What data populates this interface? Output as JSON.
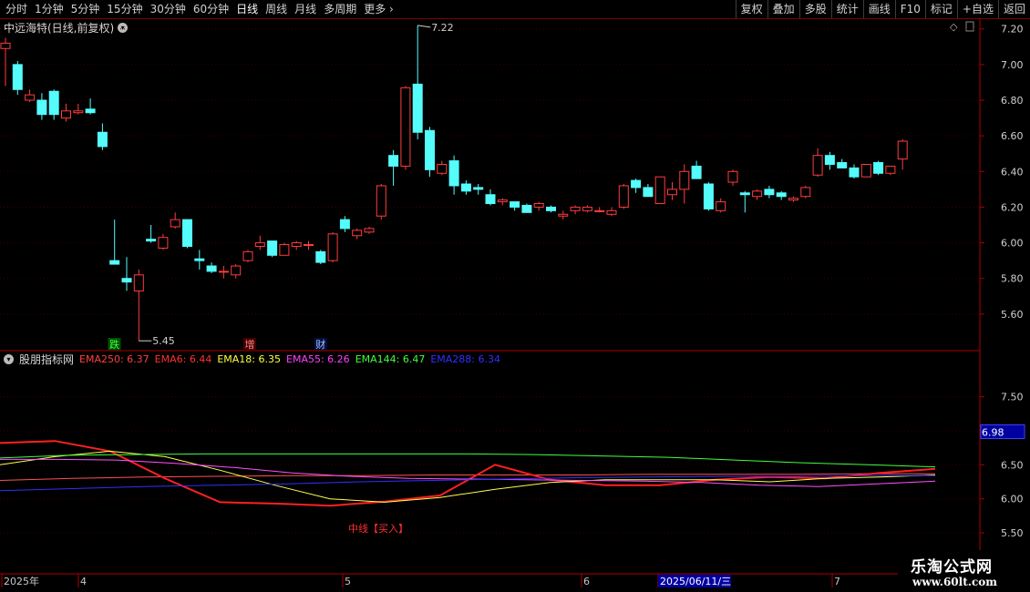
{
  "toolbar": {
    "left": [
      "分时",
      "1分钟",
      "5分钟",
      "15分钟",
      "30分钟",
      "60分钟",
      "日线",
      "周线",
      "月线",
      "多周期",
      "更多"
    ],
    "right": [
      "复权",
      "叠加",
      "多股",
      "统计",
      "画线",
      "F10",
      "标记",
      "+自选",
      "返回"
    ]
  },
  "stock_title": "中远海特(日线,前复权)",
  "indicator_name": "股朋指标网",
  "indicator_values": [
    {
      "label": "EMA250: 6.37",
      "color": "#ff4040"
    },
    {
      "label": "EMA6: 6.44",
      "color": "#ff3030"
    },
    {
      "label": "EMA18: 6.35",
      "color": "#ffff40"
    },
    {
      "label": "EMA55: 6.26",
      "color": "#ff40ff"
    },
    {
      "label": "EMA144: 6.47",
      "color": "#40ff40"
    },
    {
      "label": "EMA288: 6.34",
      "color": "#3030ff"
    }
  ],
  "colors": {
    "up": "#ff3c3c",
    "down": "#54fcfc",
    "axis": "#aa0000",
    "grid": "#3a0000"
  },
  "icons": {
    "collapse": "circle-chevron-icon",
    "diamond": "diamond-icon"
  },
  "watermark": {
    "line1": "乐淘公式网",
    "line2": "www.60lt.com"
  },
  "chart_data": [
    {
      "type": "candlestick",
      "ylim": [
        5.4,
        7.26
      ],
      "y_ticks": [
        "7.20",
        "7.00",
        "6.80",
        "6.60",
        "6.40",
        "6.20",
        "6.00",
        "5.80",
        "5.60"
      ],
      "high_label": "7.22",
      "low_label": "5.45",
      "candles": [
        {
          "o": 7.09,
          "h": 7.15,
          "l": 6.88,
          "c": 7.12
        },
        {
          "o": 7.0,
          "h": 7.02,
          "l": 6.83,
          "c": 6.86
        },
        {
          "o": 6.8,
          "h": 6.86,
          "l": 6.79,
          "c": 6.83
        },
        {
          "o": 6.8,
          "h": 6.84,
          "l": 6.69,
          "c": 6.72
        },
        {
          "o": 6.85,
          "h": 6.86,
          "l": 6.69,
          "c": 6.72
        },
        {
          "o": 6.7,
          "h": 6.78,
          "l": 6.68,
          "c": 6.74
        },
        {
          "o": 6.73,
          "h": 6.78,
          "l": 6.72,
          "c": 6.74
        },
        {
          "o": 6.75,
          "h": 6.81,
          "l": 6.72,
          "c": 6.73
        },
        {
          "o": 6.62,
          "h": 6.67,
          "l": 6.52,
          "c": 6.54
        },
        {
          "o": 5.9,
          "h": 6.13,
          "l": 5.89,
          "c": 5.88
        },
        {
          "o": 5.8,
          "h": 5.92,
          "l": 5.73,
          "c": 5.78
        },
        {
          "o": 5.73,
          "h": 5.85,
          "l": 5.45,
          "c": 5.82
        },
        {
          "o": 6.02,
          "h": 6.1,
          "l": 6.0,
          "c": 6.01
        },
        {
          "o": 5.97,
          "h": 6.05,
          "l": 5.96,
          "c": 6.03
        },
        {
          "o": 6.09,
          "h": 6.17,
          "l": 6.08,
          "c": 6.13
        },
        {
          "o": 6.13,
          "h": 6.13,
          "l": 5.97,
          "c": 5.98
        },
        {
          "o": 5.91,
          "h": 5.96,
          "l": 5.85,
          "c": 5.9
        },
        {
          "o": 5.87,
          "h": 5.89,
          "l": 5.83,
          "c": 5.84
        },
        {
          "o": 5.84,
          "h": 5.87,
          "l": 5.8,
          "c": 5.84
        },
        {
          "o": 5.82,
          "h": 5.88,
          "l": 5.8,
          "c": 5.87
        },
        {
          "o": 5.9,
          "h": 5.96,
          "l": 5.89,
          "c": 5.95
        },
        {
          "o": 5.98,
          "h": 6.04,
          "l": 5.96,
          "c": 6.0
        },
        {
          "o": 6.01,
          "h": 6.01,
          "l": 5.92,
          "c": 5.93
        },
        {
          "o": 5.93,
          "h": 6.0,
          "l": 5.93,
          "c": 5.99
        },
        {
          "o": 5.98,
          "h": 6.01,
          "l": 5.96,
          "c": 6.0
        },
        {
          "o": 5.99,
          "h": 6.01,
          "l": 5.96,
          "c": 5.99
        },
        {
          "o": 5.95,
          "h": 5.96,
          "l": 5.88,
          "c": 5.89
        },
        {
          "o": 5.9,
          "h": 6.06,
          "l": 5.89,
          "c": 6.05
        },
        {
          "o": 6.13,
          "h": 6.15,
          "l": 6.06,
          "c": 6.08
        },
        {
          "o": 6.04,
          "h": 6.08,
          "l": 6.02,
          "c": 6.07
        },
        {
          "o": 6.06,
          "h": 6.09,
          "l": 6.05,
          "c": 6.08
        },
        {
          "o": 6.15,
          "h": 6.33,
          "l": 6.13,
          "c": 6.32
        },
        {
          "o": 6.49,
          "h": 6.52,
          "l": 6.32,
          "c": 6.43
        },
        {
          "o": 6.43,
          "h": 6.88,
          "l": 6.41,
          "c": 6.87
        },
        {
          "o": 6.89,
          "h": 7.22,
          "l": 6.58,
          "c": 6.62
        },
        {
          "o": 6.63,
          "h": 6.65,
          "l": 6.37,
          "c": 6.41
        },
        {
          "o": 6.39,
          "h": 6.46,
          "l": 6.38,
          "c": 6.44
        },
        {
          "o": 6.46,
          "h": 6.49,
          "l": 6.27,
          "c": 6.32
        },
        {
          "o": 6.33,
          "h": 6.35,
          "l": 6.27,
          "c": 6.29
        },
        {
          "o": 6.31,
          "h": 6.33,
          "l": 6.27,
          "c": 6.3
        },
        {
          "o": 6.27,
          "h": 6.3,
          "l": 6.21,
          "c": 6.22
        },
        {
          "o": 6.23,
          "h": 6.25,
          "l": 6.21,
          "c": 6.24
        },
        {
          "o": 6.23,
          "h": 6.23,
          "l": 6.18,
          "c": 6.2
        },
        {
          "o": 6.21,
          "h": 6.22,
          "l": 6.17,
          "c": 6.17
        },
        {
          "o": 6.2,
          "h": 6.23,
          "l": 6.18,
          "c": 6.22
        },
        {
          "o": 6.2,
          "h": 6.21,
          "l": 6.17,
          "c": 6.18
        },
        {
          "o": 6.15,
          "h": 6.18,
          "l": 6.13,
          "c": 6.16
        },
        {
          "o": 6.18,
          "h": 6.21,
          "l": 6.16,
          "c": 6.2
        },
        {
          "o": 6.18,
          "h": 6.21,
          "l": 6.17,
          "c": 6.2
        },
        {
          "o": 6.18,
          "h": 6.2,
          "l": 6.17,
          "c": 6.18
        },
        {
          "o": 6.16,
          "h": 6.2,
          "l": 6.15,
          "c": 6.18
        },
        {
          "o": 6.2,
          "h": 6.33,
          "l": 6.19,
          "c": 6.32
        },
        {
          "o": 6.35,
          "h": 6.36,
          "l": 6.28,
          "c": 6.31
        },
        {
          "o": 6.31,
          "h": 6.33,
          "l": 6.26,
          "c": 6.26
        },
        {
          "o": 6.22,
          "h": 6.37,
          "l": 6.22,
          "c": 6.37
        },
        {
          "o": 6.27,
          "h": 6.34,
          "l": 6.24,
          "c": 6.3
        },
        {
          "o": 6.3,
          "h": 6.44,
          "l": 6.22,
          "c": 6.4
        },
        {
          "o": 6.43,
          "h": 6.46,
          "l": 6.38,
          "c": 6.36
        },
        {
          "o": 6.33,
          "h": 6.34,
          "l": 6.18,
          "c": 6.19
        },
        {
          "o": 6.18,
          "h": 6.25,
          "l": 6.17,
          "c": 6.23
        },
        {
          "o": 6.34,
          "h": 6.41,
          "l": 6.32,
          "c": 6.4
        },
        {
          "o": 6.28,
          "h": 6.29,
          "l": 6.17,
          "c": 6.27
        },
        {
          "o": 6.26,
          "h": 6.3,
          "l": 6.24,
          "c": 6.29
        },
        {
          "o": 6.3,
          "h": 6.32,
          "l": 6.25,
          "c": 6.27
        },
        {
          "o": 6.28,
          "h": 6.29,
          "l": 6.24,
          "c": 6.26
        },
        {
          "o": 6.24,
          "h": 6.26,
          "l": 6.23,
          "c": 6.25
        },
        {
          "o": 6.26,
          "h": 6.32,
          "l": 6.25,
          "c": 6.31
        },
        {
          "o": 6.38,
          "h": 6.53,
          "l": 6.37,
          "c": 6.49
        },
        {
          "o": 6.49,
          "h": 6.51,
          "l": 6.41,
          "c": 6.44
        },
        {
          "o": 6.45,
          "h": 6.47,
          "l": 6.42,
          "c": 6.42
        },
        {
          "o": 6.42,
          "h": 6.44,
          "l": 6.36,
          "c": 6.37
        },
        {
          "o": 6.37,
          "h": 6.44,
          "l": 6.37,
          "c": 6.44
        },
        {
          "o": 6.45,
          "h": 6.46,
          "l": 6.38,
          "c": 6.39
        },
        {
          "o": 6.39,
          "h": 6.43,
          "l": 6.38,
          "c": 6.43
        },
        {
          "o": 6.47,
          "h": 6.58,
          "l": 6.41,
          "c": 6.57
        }
      ],
      "markers": [
        {
          "index": 9,
          "text": "跌",
          "color": "#40ff40",
          "bg": "#005000"
        },
        {
          "index": 20,
          "text": "增",
          "color": "#ff8080",
          "bg": "#400000"
        },
        {
          "index": 26,
          "text": "财",
          "color": "#a0c0ff",
          "bg": "#001040"
        }
      ]
    },
    {
      "type": "line",
      "ylim": [
        5.3,
        7.95
      ],
      "y_ticks": [
        "7.50",
        "7.00",
        "6.50",
        "6.00",
        "5.50"
      ],
      "current_value_label": "6.98",
      "annotation": "中线【买入】",
      "series": [
        {
          "name": "EMA250",
          "color": "#ff5050",
          "width": 1,
          "values": [
            6.27,
            6.3,
            6.32,
            6.33,
            6.34,
            6.34,
            6.35,
            6.35,
            6.35,
            6.36,
            6.36,
            6.36,
            6.37,
            6.37
          ]
        },
        {
          "name": "EMA6",
          "color": "#ff2020",
          "width": 2,
          "values": [
            6.82,
            6.85,
            6.7,
            6.3,
            5.95,
            5.93,
            5.9,
            5.96,
            6.05,
            6.5,
            6.28,
            6.2,
            6.2,
            6.28,
            6.32,
            6.3,
            6.38,
            6.44
          ]
        },
        {
          "name": "EMA18",
          "color": "#ffff50",
          "width": 1,
          "values": [
            6.5,
            6.62,
            6.7,
            6.62,
            6.42,
            6.2,
            6.0,
            5.95,
            6.02,
            6.14,
            6.24,
            6.28,
            6.28,
            6.28,
            6.25,
            6.3,
            6.32,
            6.35
          ]
        },
        {
          "name": "EMA55",
          "color": "#ff50ff",
          "width": 1,
          "values": [
            6.58,
            6.58,
            6.57,
            6.52,
            6.46,
            6.38,
            6.33,
            6.3,
            6.29,
            6.28,
            6.27,
            6.26,
            6.24,
            6.2,
            6.18,
            6.22,
            6.26
          ]
        },
        {
          "name": "EMA144",
          "color": "#40ff40",
          "width": 1,
          "values": [
            6.6,
            6.64,
            6.65,
            6.66,
            6.66,
            6.66,
            6.66,
            6.66,
            6.65,
            6.63,
            6.61,
            6.57,
            6.53,
            6.5,
            6.47
          ]
        },
        {
          "name": "EMA288",
          "color": "#3030ff",
          "width": 1,
          "values": [
            6.12,
            6.15,
            6.18,
            6.2,
            6.22,
            6.25,
            6.27,
            6.29,
            6.31,
            6.32,
            6.33,
            6.33,
            6.34,
            6.34
          ]
        }
      ]
    }
  ],
  "x_axis": {
    "labels": [
      "2025年",
      "4",
      "5",
      "6",
      "2025/06/11/三",
      "7"
    ]
  }
}
